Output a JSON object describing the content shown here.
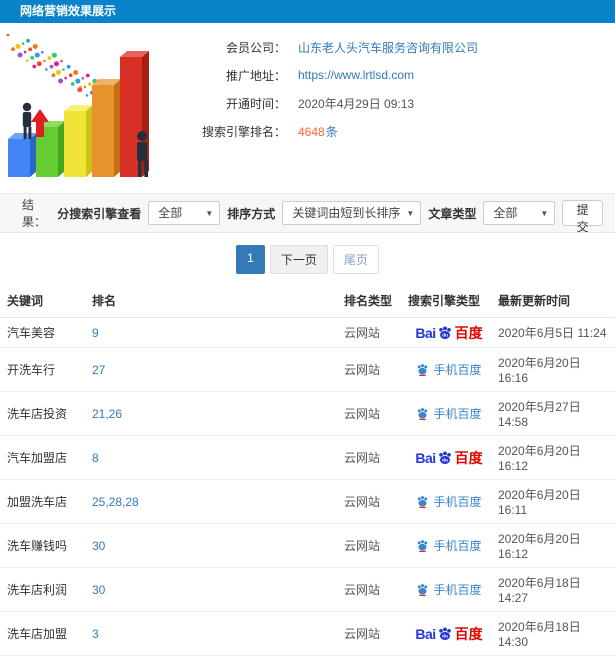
{
  "header": {
    "title": "网络营销效果展示"
  },
  "info": {
    "member_label": "会员公司：",
    "member_value": "山东老人头汽车服务咨询有限公司",
    "url_label": "推广地址：",
    "url_value": "https://www.lrtlsd.com",
    "open_label": "开通时间：",
    "open_value": "2020年4月29日 09:13",
    "rank_label": "搜索引擎排名：",
    "rank_count": "4648",
    "rank_unit": "条"
  },
  "filters": {
    "result_label": "结果：",
    "engine_label": "分搜索引擎查看",
    "engine_value": "全部",
    "sort_label": "排序方式",
    "sort_value": "关键词由短到长排序",
    "type_label": "文章类型",
    "type_value": "全部",
    "submit_label": "提交",
    "caret": "▼"
  },
  "pagination": {
    "page": "1",
    "next": "下一页",
    "last": "尾页"
  },
  "table": {
    "headers": [
      "关键词",
      "排名",
      "排名类型",
      "搜索引擎类型",
      "最新更新时间"
    ],
    "rows": [
      {
        "keyword": "汽车美容",
        "rank": "9",
        "rank_type": "云网站",
        "engine": "baidu",
        "updated": "2020年6月5日 11:24"
      },
      {
        "keyword": "开洗车行",
        "rank": "27",
        "rank_type": "云网站",
        "engine": "mobile-baidu",
        "updated": "2020年6月20日 16:16"
      },
      {
        "keyword": "洗车店投资",
        "rank": "21,26",
        "rank_type": "云网站",
        "engine": "mobile-baidu",
        "updated": "2020年5月27日 14:58"
      },
      {
        "keyword": "汽车加盟店",
        "rank": "8",
        "rank_type": "云网站",
        "engine": "baidu",
        "updated": "2020年6月20日 16:12"
      },
      {
        "keyword": "加盟洗车店",
        "rank": "25,28,28",
        "rank_type": "云网站",
        "engine": "mobile-baidu",
        "updated": "2020年6月20日 16:11"
      },
      {
        "keyword": "洗车赚钱吗",
        "rank": "30",
        "rank_type": "云网站",
        "engine": "mobile-baidu",
        "updated": "2020年6月20日 16:12"
      },
      {
        "keyword": "洗车店利润",
        "rank": "30",
        "rank_type": "云网站",
        "engine": "mobile-baidu",
        "updated": "2020年6月18日 14:27"
      },
      {
        "keyword": "洗车店加盟",
        "rank": "3",
        "rank_type": "云网站",
        "engine": "baidu",
        "updated": "2020年6月18日 14:30"
      }
    ]
  },
  "engine_labels": {
    "baidu_prefix": "Bai",
    "baidu_suffix": "百度",
    "mobile": "手机百度"
  },
  "colors": {
    "header_bg": "#0883c9",
    "link": "#337ab7",
    "accent_orange": "#ff6633",
    "pagination_active": "#337ab7",
    "baidu_blue": "#2534dd",
    "baidu_red": "#e10602",
    "mobile_blue": "#3a87d0"
  }
}
